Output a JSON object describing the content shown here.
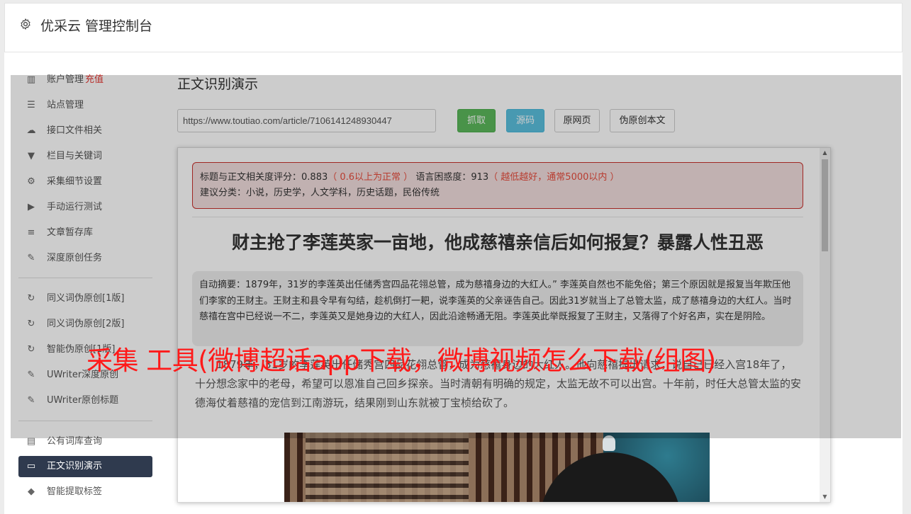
{
  "header": {
    "title": "优采云 管理控制台"
  },
  "sidebar": {
    "items": [
      {
        "label": "账户管理",
        "badge": "充值",
        "icon": "bar-chart-icon"
      },
      {
        "label": "站点管理",
        "icon": "server-icon"
      },
      {
        "label": "接口文件相关",
        "icon": "cloud-upload-icon"
      },
      {
        "label": "栏目与关键词",
        "icon": "filter-icon"
      },
      {
        "label": "采集细节设置",
        "icon": "cogs-icon"
      },
      {
        "label": "手动运行测试",
        "icon": "play-icon"
      },
      {
        "label": "文章暂存库",
        "icon": "database-icon"
      },
      {
        "label": "深度原创任务",
        "icon": "edit-icon"
      },
      {
        "label": "同义词伪原创[1版]",
        "icon": "refresh-icon"
      },
      {
        "label": "同义词伪原创[2版]",
        "icon": "refresh-icon"
      },
      {
        "label": "智能伪原创[1版]",
        "icon": "refresh-icon"
      },
      {
        "label": "UWriter深度原创",
        "icon": "edit-icon"
      },
      {
        "label": "UWriter原创标题",
        "icon": "edit-icon"
      },
      {
        "label": "公有词库查询",
        "icon": "book-icon"
      },
      {
        "label": "正文识别演示",
        "icon": "monitor-icon",
        "active": true
      },
      {
        "label": "智能提取标签",
        "icon": "tag-icon"
      }
    ]
  },
  "main": {
    "title": "正文识别演示",
    "url_value": "https://www.toutiao.com/article/7106141248930447",
    "buttons": {
      "fetch": "抓取",
      "source": "源码",
      "original": "原网页",
      "rewrite": "伪原创本文"
    }
  },
  "result": {
    "score_label": "标题与正文相关度评分：",
    "score_value": "0.883",
    "score_note": "（ 0.6以上为正常 ）",
    "perplexity_label": "语言困惑度：",
    "perplexity_value": "913",
    "perplexity_note": "（ 越低越好，通常5000以内 ）",
    "category_line": "建议分类：小说，历史学，人文学科，历史话题，民俗传统",
    "article_title": "财主抢了李莲英家一亩地，他成慈禧亲信后如何报复？暴露人性丑恶",
    "summary": "自动摘要：1879年，31岁的李莲英出任储秀宫四品花翎总管，成为慈禧身边的大红人。” 李莲英自然也不能免俗；第三个原因就是报复当年欺压他们李家的王财主。王财主和县令早有勾结，趁机倒打一耙，说李莲英的父亲诬告自己。因此31岁就当上了总管太监，成了慈禧身边的大红人。当时慈禧在宫中已经说一不二，李莲英又是她身边的大红人，因此沿途畅通无阻。李莲英此举既报复了王财主，又落得了个好名声，实在是阴险。",
    "body_text": "1879年，31岁的李莲英出任储秀宫四品花翎总管，成为慈禧身边的大红人。他向慈禧提出请求，说自己已经入宫18年了，十分想念家中的老母，希望可以恩准自己回乡探亲。当时清朝有明确的规定，太监无故不可以出宫。十年前，时任大总管太监的安德海仗着慈禧的宠信到江南游玩，结果刚到山东就被丁宝桢给砍了。"
  },
  "watermark": "采集 工具(微博超话app下载，微博视频怎么下载(组图)"
}
